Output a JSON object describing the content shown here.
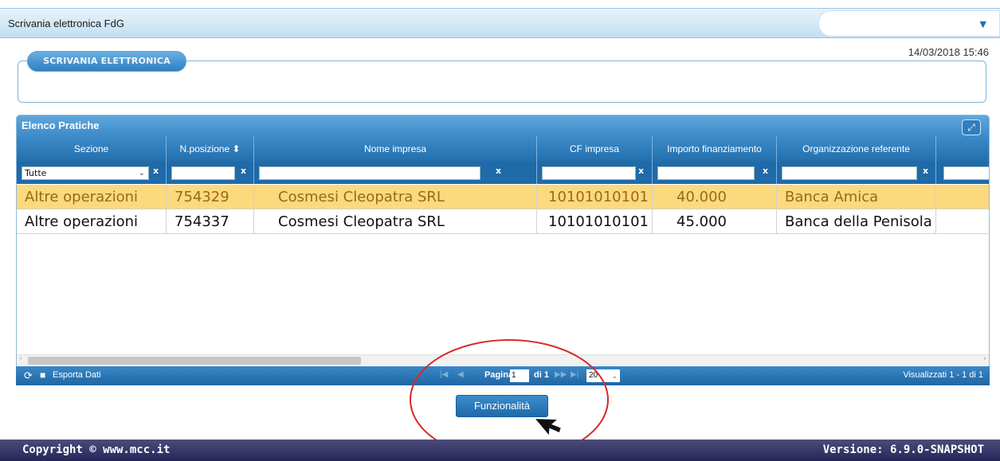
{
  "header": {
    "app_title": "Scrivania elettronica   FdG",
    "user_dropdown_arrow": "▼",
    "datetime": "14/03/2018 15:46"
  },
  "section": {
    "legend": "SCRIVANIA ELETTRONICA"
  },
  "grid": {
    "caption": "Elenco Pratiche",
    "columns": [
      {
        "label": "Sezione"
      },
      {
        "label": "N.posizione"
      },
      {
        "label": "Nome impresa"
      },
      {
        "label": "CF impresa"
      },
      {
        "label": "Importo finanziamento"
      },
      {
        "label": "Organizzazione referente"
      }
    ],
    "sort_icon": "⬍",
    "filters": {
      "sezione_value": "Tutte",
      "clear_label": "x"
    },
    "rows": [
      [
        "Altre operazioni",
        "754329",
        "Cosmesi Cleopatra SRL",
        "10101010101",
        "40.000",
        "Banca Amica"
      ],
      [
        "Altre operazioni",
        "754337",
        "Cosmesi Cleopatra SRL",
        "10101010101",
        "45.000",
        "Banca della Penisola"
      ]
    ]
  },
  "pager": {
    "export_label": "Esporta Dati",
    "page_label": "Pagina",
    "page_value": "1",
    "of_label": "di 1",
    "rows_per_page": "20",
    "summary": "Visualizzati 1 - 1 di 1"
  },
  "actions": {
    "funzionalita_label": "Funzionalità"
  },
  "footer": {
    "copyright": "Copyright © www.mcc.it",
    "version": "Versione: 6.9.0-SNAPSHOT"
  },
  "colors": {
    "accent": "#3d8bc9",
    "selected_row": "#fbd97d",
    "footer_bg": "#26255a",
    "annotation_ring": "#d72828"
  }
}
